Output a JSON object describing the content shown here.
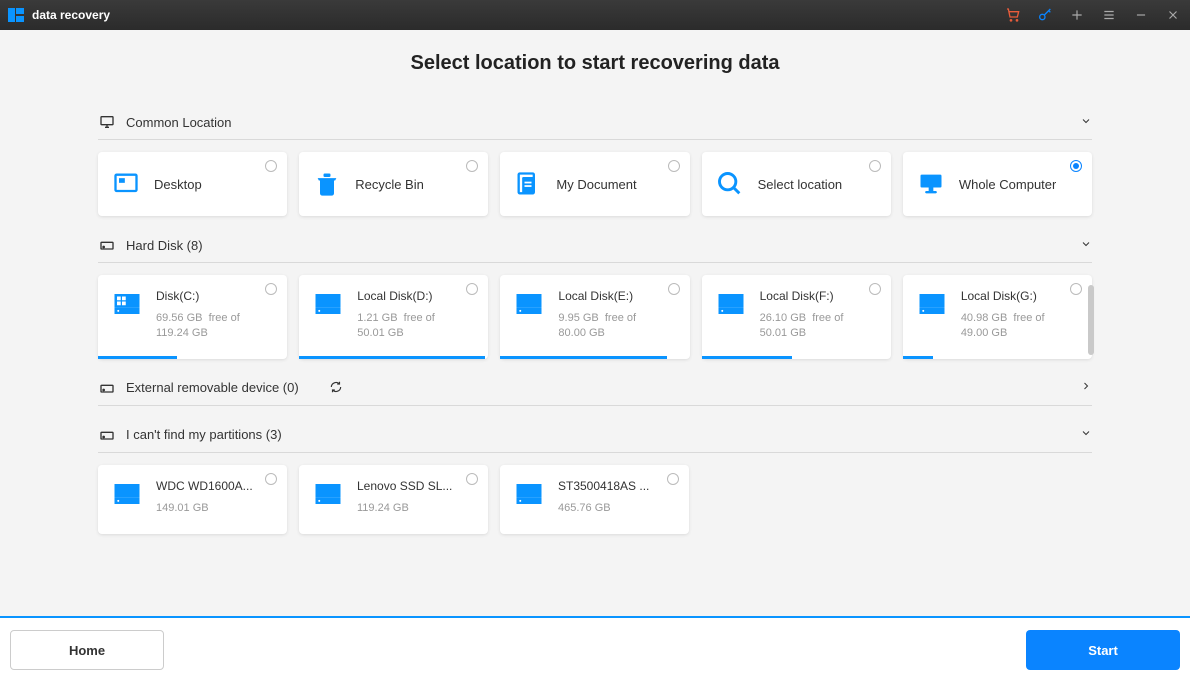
{
  "app_title": "data recovery",
  "page_heading": "Select location to start recovering data",
  "sections": {
    "common": {
      "title": "Common Location"
    },
    "hard_disk": {
      "title": "Hard Disk (8)"
    },
    "external": {
      "title": "External removable device (0)"
    },
    "lost": {
      "title": "I can't find my partitions (3)"
    }
  },
  "common_items": [
    {
      "label": "Desktop",
      "selected": false
    },
    {
      "label": "Recycle Bin",
      "selected": false
    },
    {
      "label": "My Document",
      "selected": false
    },
    {
      "label": "Select location",
      "selected": false
    },
    {
      "label": "Whole Computer",
      "selected": true
    }
  ],
  "disks": [
    {
      "name": "Disk(C:)",
      "free": "69.56 GB",
      "total": "119.24 GB",
      "fill_pct": 42
    },
    {
      "name": "Local Disk(D:)",
      "free": "1.21 GB",
      "total": "50.01 GB",
      "fill_pct": 98
    },
    {
      "name": "Local Disk(E:)",
      "free": "9.95 GB",
      "total": "80.00 GB",
      "fill_pct": 88
    },
    {
      "name": "Local Disk(F:)",
      "free": "26.10 GB",
      "total": "50.01 GB",
      "fill_pct": 48
    },
    {
      "name": "Local Disk(G:)",
      "free": "40.98 GB",
      "total": "49.00 GB",
      "fill_pct": 16
    }
  ],
  "lost_items": [
    {
      "name": "WDC WD1600A...",
      "size": "149.01 GB"
    },
    {
      "name": "Lenovo SSD SL...",
      "size": "119.24 GB"
    },
    {
      "name": "ST3500418AS ...",
      "size": "465.76 GB"
    }
  ],
  "buttons": {
    "home": "Home",
    "start": "Start"
  }
}
